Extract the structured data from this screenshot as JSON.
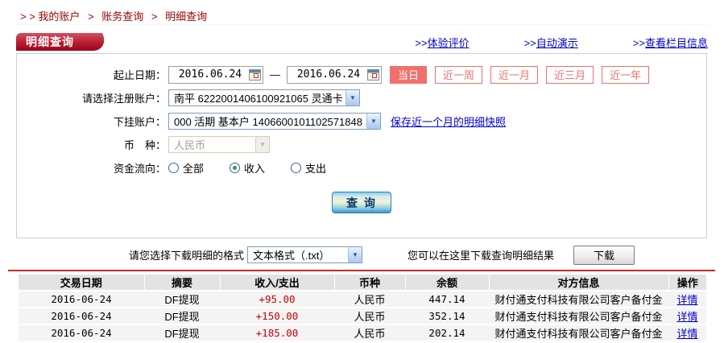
{
  "breadcrumb": {
    "prefix": "> >",
    "separator": ">",
    "items": [
      "我的账户",
      "账务查询",
      "明细查询"
    ]
  },
  "header": {
    "tab_title": "明细查询",
    "links": [
      {
        "prefix": ">>",
        "label": "体验评价"
      },
      {
        "prefix": ">>",
        "label": "自动演示"
      },
      {
        "prefix": ">>",
        "label": "查看栏目信息"
      }
    ]
  },
  "form": {
    "date_label": "起止日期：",
    "date_from": "2016.06.24",
    "date_to": "2016.06.24",
    "date_separator": "—",
    "period_buttons": [
      {
        "label": "当日",
        "active": true
      },
      {
        "label": "近一周",
        "active": false
      },
      {
        "label": "近一月",
        "active": false
      },
      {
        "label": "近三月",
        "active": false
      },
      {
        "label": "近一年",
        "active": false
      }
    ],
    "account_label": "请选择注册账户：",
    "account_value": "南平 6222001406100921065 灵通卡",
    "sub_account_label": "下挂账户：",
    "sub_account_value": "000 活期 基本户 1406600101102571848",
    "snapshot_link": "保存近一个月的明细快照",
    "currency_label": "币　种：",
    "currency_value": "人民币",
    "flow_label": "资金流向：",
    "flow_options": [
      {
        "label": "全部",
        "checked": false
      },
      {
        "label": "收入",
        "checked": true
      },
      {
        "label": "支出",
        "checked": false
      }
    ],
    "query_button_label": "查 询",
    "dropdown_arrow": "▼"
  },
  "download": {
    "format_label": "请您选择下载明细的格式",
    "format_value": "文本格式（.txt）",
    "hint": "您可以在这里下载查询明细结果",
    "button_label": "下载"
  },
  "table": {
    "headers": [
      "交易日期",
      "摘要",
      "收入/支出",
      "币种",
      "余额",
      "对方信息",
      "操作"
    ],
    "rows": [
      {
        "date": "2016-06-24",
        "summary": "DF提现",
        "amount": "+95.00",
        "currency": "人民币",
        "balance": "447.14",
        "counterparty": "财付通支付科技有限公司客户备付金",
        "action": "详情"
      },
      {
        "date": "2016-06-24",
        "summary": "DF提现",
        "amount": "+150.00",
        "currency": "人民币",
        "balance": "352.14",
        "counterparty": "财付通支付科技有限公司客户备付金",
        "action": "详情"
      },
      {
        "date": "2016-06-24",
        "summary": "DF提现",
        "amount": "+185.00",
        "currency": "人民币",
        "balance": "202.14",
        "counterparty": "财付通支付科技有限公司客户备付金",
        "action": "详情"
      }
    ]
  },
  "colors": {
    "breadcrumb_red": "#990000",
    "tab_red": "#b81c30",
    "link_blue": "#0000cc",
    "period_salmon": "#ef706b",
    "amount_red": "#cc0000",
    "divider_red": "#cc2626",
    "table_header_bg": "#e3e3e3",
    "table_row_bg": "#f4f4f4"
  }
}
